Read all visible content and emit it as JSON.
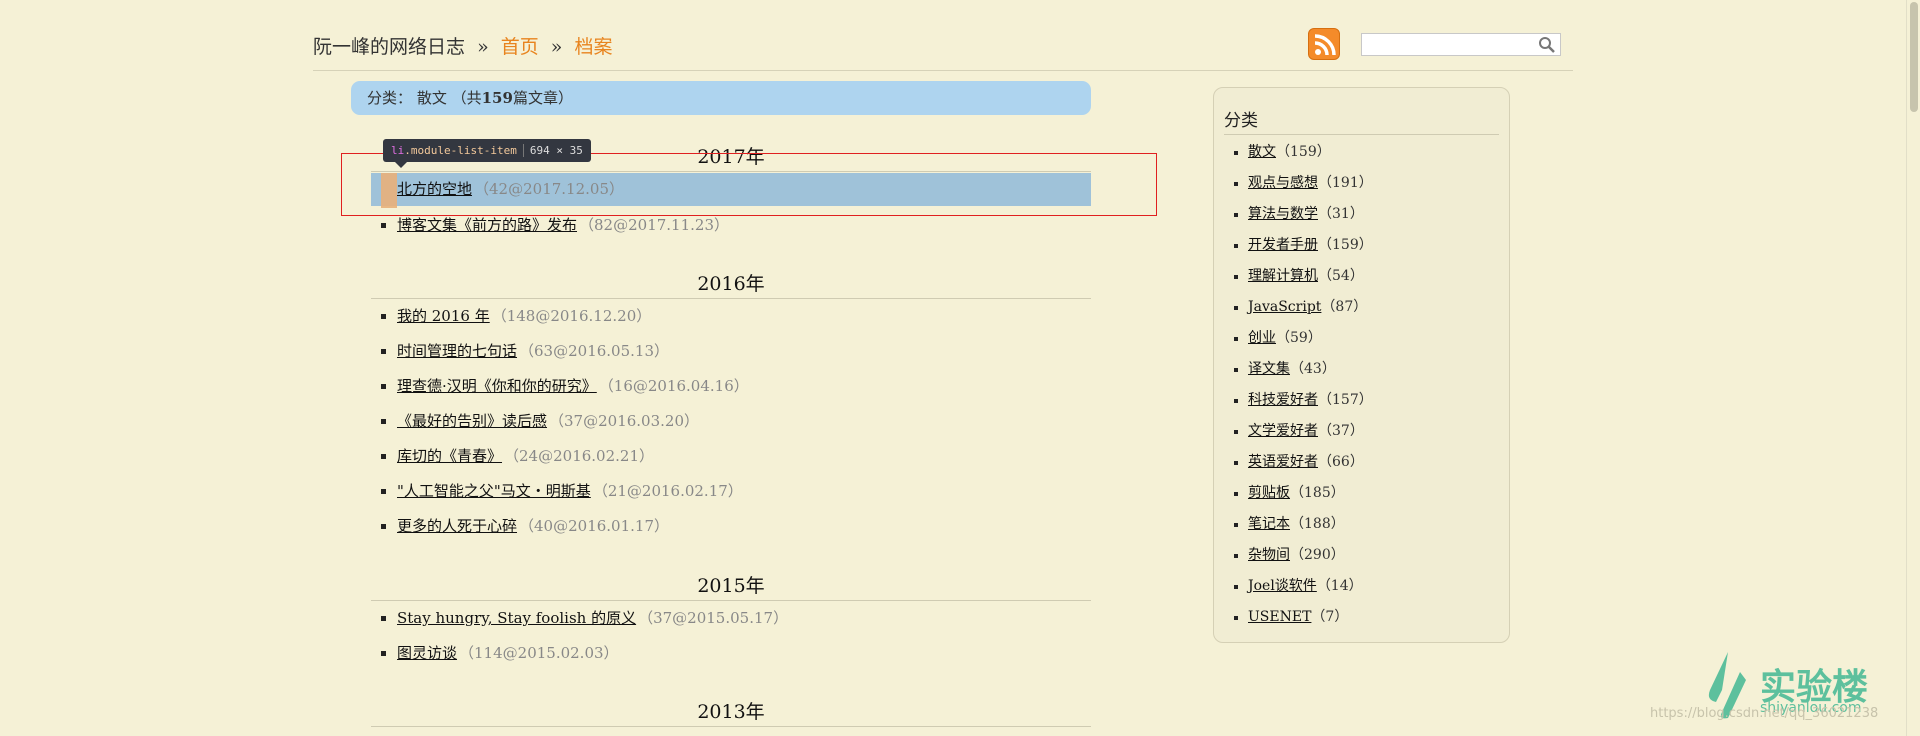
{
  "header": {
    "site_title": "阮一峰的网络日志",
    "sep": "»",
    "home": "首页",
    "archive": "档案",
    "search_placeholder": ""
  },
  "category_bar": {
    "label": "分类",
    "colon": "：",
    "name": "散文",
    "count_prefix": "（共",
    "count": "159",
    "count_suffix": "篇文章）"
  },
  "devtools_tooltip": {
    "tag": "li",
    "cls": ".module-list-item",
    "dims": "694 × 35"
  },
  "years": [
    {
      "label": "2017年"
    },
    {
      "label": "2016年"
    },
    {
      "label": "2015年"
    },
    {
      "label": "2013年"
    }
  ],
  "posts": [
    {
      "title": "北方的空地",
      "meta": "（42@2017.12.05）"
    },
    {
      "title": "博客文集《前方的路》发布",
      "meta": "（82@2017.11.23）"
    },
    {
      "title": "我的 2016 年",
      "meta": "（148@2016.12.20）"
    },
    {
      "title": "时间管理的七句话",
      "meta": "（63@2016.05.13）"
    },
    {
      "title": "理查德·汉明《你和你的研究》",
      "meta": "（16@2016.04.16）"
    },
    {
      "title": "《最好的告别》读后感",
      "meta": "（37@2016.03.20）"
    },
    {
      "title": "库切的《青春》",
      "meta": "（24@2016.02.21）"
    },
    {
      "title": "\"人工智能之父\"马文・明斯基",
      "meta": "（21@2016.02.17）"
    },
    {
      "title": "更多的人死于心碎",
      "meta": "（40@2016.01.17）"
    },
    {
      "title": "Stay hungry, Stay foolish 的原义",
      "meta": "（37@2015.05.17）"
    },
    {
      "title": "图灵访谈",
      "meta": "（114@2015.02.03）"
    }
  ],
  "sidebar": {
    "title": "分类",
    "items": [
      {
        "name": "散文",
        "count": "（159）"
      },
      {
        "name": "观点与感想",
        "count": "（191）"
      },
      {
        "name": "算法与数学",
        "count": "（31）"
      },
      {
        "name": "开发者手册",
        "count": "（159）"
      },
      {
        "name": "理解计算机",
        "count": "（54）"
      },
      {
        "name": "JavaScript",
        "count": "（87）"
      },
      {
        "name": "创业",
        "count": "（59）"
      },
      {
        "name": "译文集",
        "count": "（43）"
      },
      {
        "name": "科技爱好者",
        "count": "（157）"
      },
      {
        "name": "文学爱好者",
        "count": "（37）"
      },
      {
        "name": "英语爱好者",
        "count": "（66）"
      },
      {
        "name": "剪贴板",
        "count": "（185）"
      },
      {
        "name": "笔记本",
        "count": "（188）"
      },
      {
        "name": "杂物间",
        "count": "（290）"
      },
      {
        "name": "Joel谈软件",
        "count": "（14）"
      },
      {
        "name": "USENET",
        "count": "（7）"
      }
    ]
  },
  "watermark": {
    "cn": "实验楼",
    "en": "shiyanlou.com",
    "url": "https://blog.csdn.net/qq_36021238"
  },
  "colors": {
    "page_bg": "#f5f1d6",
    "link_accent": "#e8841e",
    "category_bar_bg": "#aed4ef",
    "highlight": "#9fc2d9",
    "inspect_border": "#e02020"
  }
}
